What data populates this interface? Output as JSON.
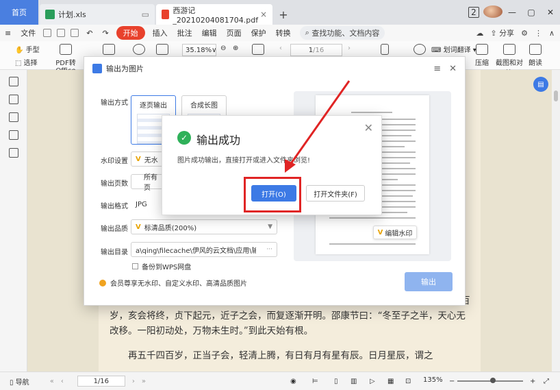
{
  "tabs": [
    {
      "label": "首页"
    },
    {
      "label": "计划.xls"
    },
    {
      "label": "西游记_20210204081704.pdf"
    }
  ],
  "window": {
    "badge": "2"
  },
  "menu": {
    "file": "文件",
    "start": "开始",
    "items": [
      "插入",
      "批注",
      "编辑",
      "页面",
      "保护",
      "转换"
    ],
    "search": "查找功能、文档内容",
    "share": "分享"
  },
  "ribbon": {
    "hand": "手型",
    "select": "选择",
    "pdf_to_office": "PDF转Office",
    "zoom": "35.18%",
    "page_current": "1",
    "page_total": "/16",
    "translate": "划词翻译",
    "compress": "压缩",
    "screenshot": "截图和对比",
    "read_aloud": "朗读"
  },
  "dialog": {
    "title": "输出为图片",
    "labels": {
      "mode": "输出方式",
      "watermark": "水印设置",
      "pages": "输出页数",
      "format": "输出格式",
      "quality": "输出品质",
      "dir": "输出目录"
    },
    "modes": [
      "逐页输出",
      "合成长图"
    ],
    "watermark_value": "无水",
    "pages_value": "所有页",
    "format_value": "JPG",
    "quality_value": "标清品质(200%)",
    "dir_value": "a\\qing\\filecache\\伊风的云文档\\应用\\输出为PDF\\",
    "dir_more": "···",
    "backup": "备份到WPS网盘",
    "member_note": "会员尊享无水印、自定义水印、高清品质图片",
    "watermark_edit": "编辑水印",
    "export": "输出"
  },
  "popup": {
    "title": "输出成功",
    "message": "图片成功输出，直接打开或进入文件夹浏览!",
    "open": "打开(O)",
    "open_folder": "打开文件夹(F)"
  },
  "doc": {
    "para1": "再五千四百岁，交亥会之初，则当黑暗，而两间人物俱无矣，故曰混沌。又五千四百岁，亥会将终，贞下起元，近子之会，而复逐渐开明。邵康节曰：“冬至子之半，天心无改移。一阳初动处，万物未生时。”到此天始有根。",
    "para2": "再五千四百岁，正当子会，轻清上腾，有日有月有星有辰。日月星辰，谓之"
  },
  "status": {
    "nav": "导航",
    "page": "1/16",
    "zoom": "135%"
  }
}
